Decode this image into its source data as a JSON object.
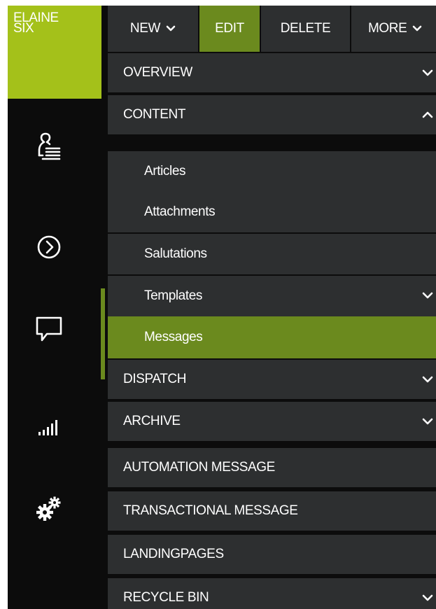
{
  "brand": {
    "line1": "ELAINE",
    "line2": "SIX",
    "color": "#a4c11a"
  },
  "rail": {
    "items": [
      {
        "icon": "user-list-icon"
      },
      {
        "icon": "circle-arrow-right-icon"
      },
      {
        "icon": "speech-bubble-icon"
      },
      {
        "icon": "signal-bars-icon"
      },
      {
        "icon": "gears-icon"
      }
    ]
  },
  "toolbar": {
    "new_label": "NEW",
    "edit_label": "EDIT",
    "delete_label": "DELETE",
    "more_label": "MORE"
  },
  "nav": {
    "overview": "OVERVIEW",
    "content": "CONTENT",
    "content_items": [
      "Articles",
      "Attachments",
      "Salutations",
      "Templates",
      "Messages"
    ],
    "dispatch": "DISPATCH",
    "archive": "ARCHIVE",
    "automation": "AUTOMATION MESSAGE",
    "transactional": "TRANSACTIONAL MESSAGE",
    "landingpages": "LANDINGPAGES",
    "recycle_bin": "RECYCLE BIN"
  },
  "colors": {
    "accent": "#6b8a1e",
    "panel": "#2d2f30",
    "background": "#0c0c0c"
  }
}
